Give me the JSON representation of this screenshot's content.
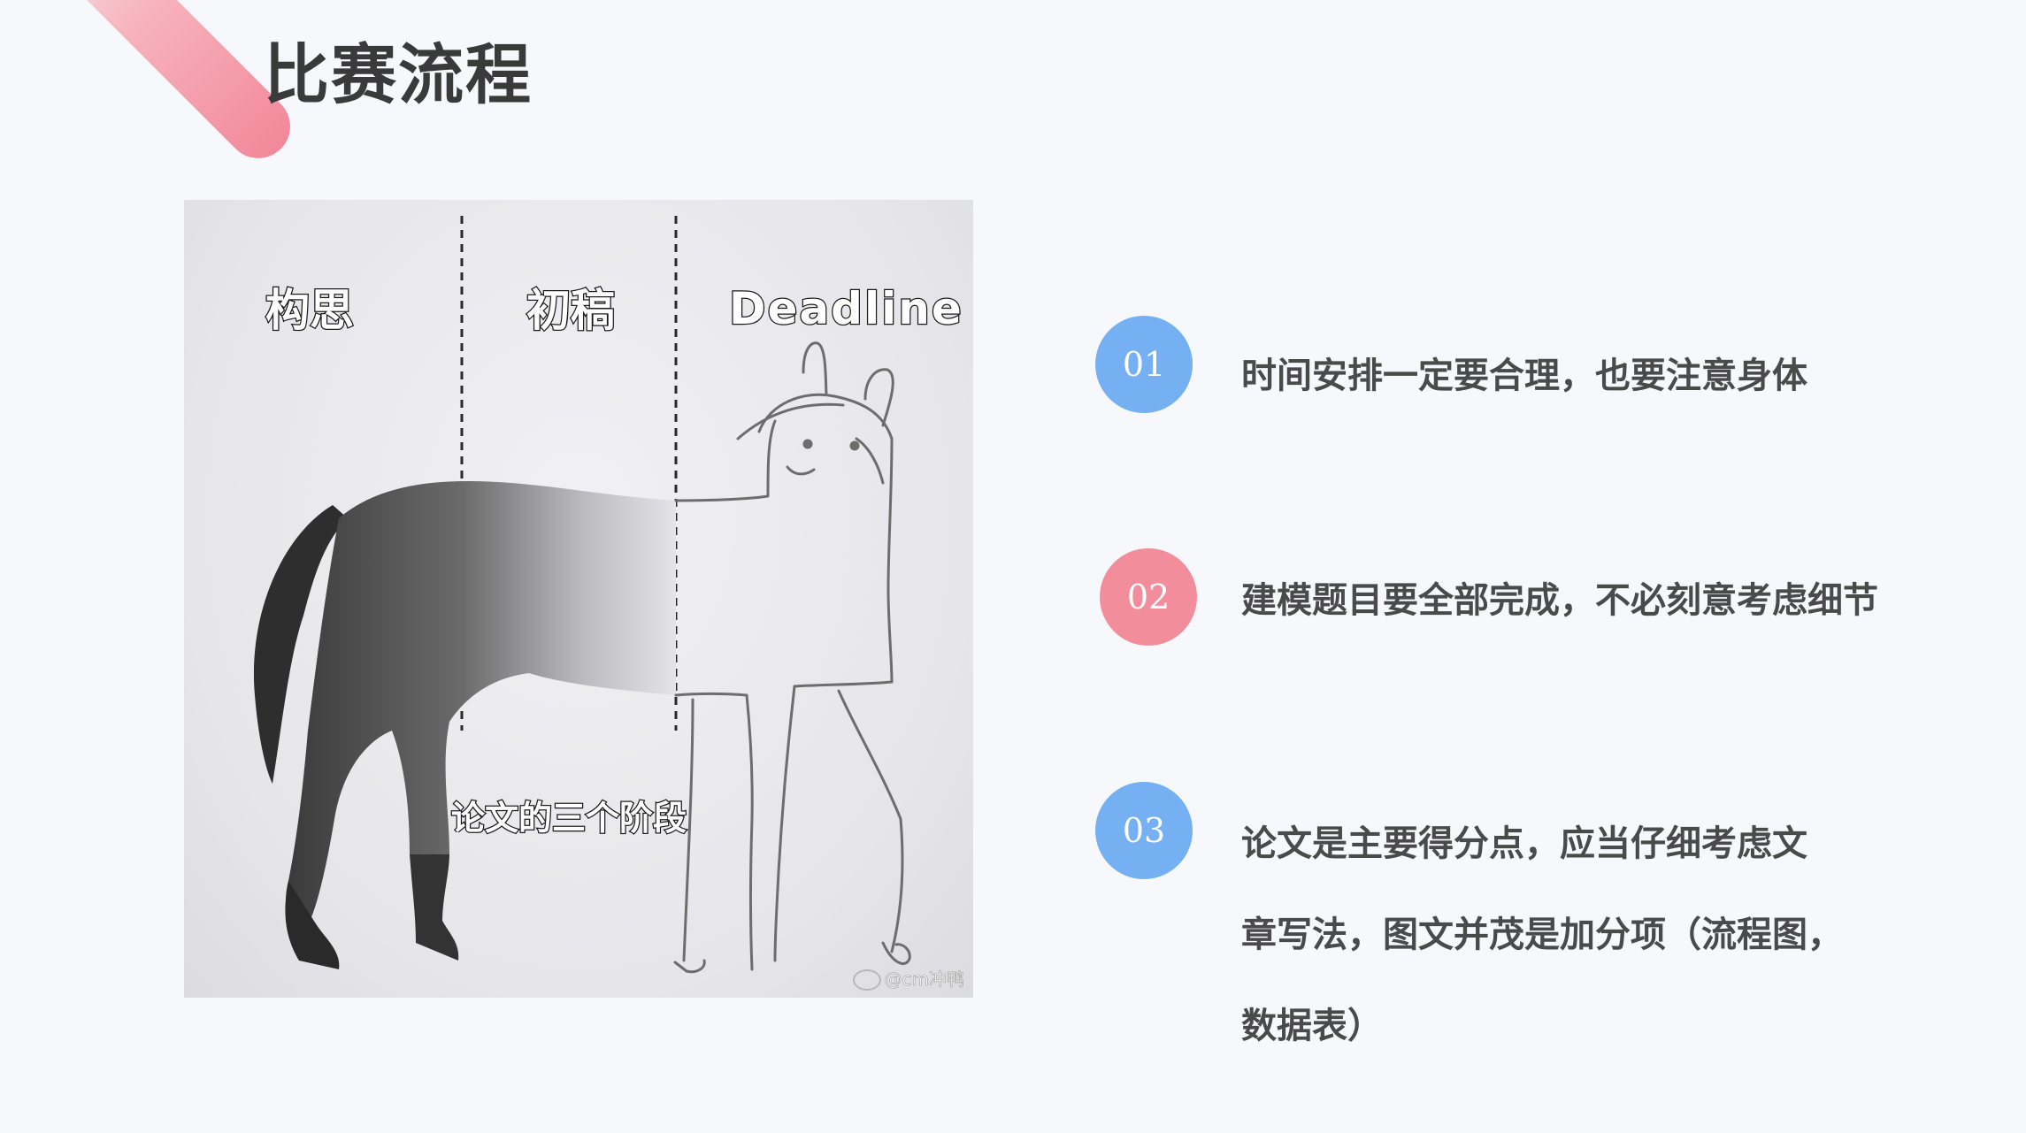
{
  "slide": {
    "title": "比赛流程"
  },
  "meme": {
    "stage_labels": [
      "构思",
      "初稿",
      "Deadline"
    ],
    "caption": "论文的三个阶段",
    "watermark": "@cm冲鸭"
  },
  "items": [
    {
      "number": "01",
      "color": "#74b0f2",
      "lines": [
        "时间安排一定要合理，也要注意身体"
      ]
    },
    {
      "number": "02",
      "color": "#f28e9c",
      "lines": [
        "建模题目要全部完成，不必刻意考虑细节"
      ]
    },
    {
      "number": "03",
      "color": "#74b0f2",
      "lines": [
        "论文是主要得分点，应当仔细考虑文",
        "章写法，图文并茂是加分项（流程图，",
        "数据表）"
      ]
    }
  ],
  "colors": {
    "background": "#f7f8fb",
    "accent_pink": "#f28e9c",
    "accent_blue": "#74b0f2",
    "title_text": "#3a3a3a",
    "body_text": "#4a4a4a"
  }
}
